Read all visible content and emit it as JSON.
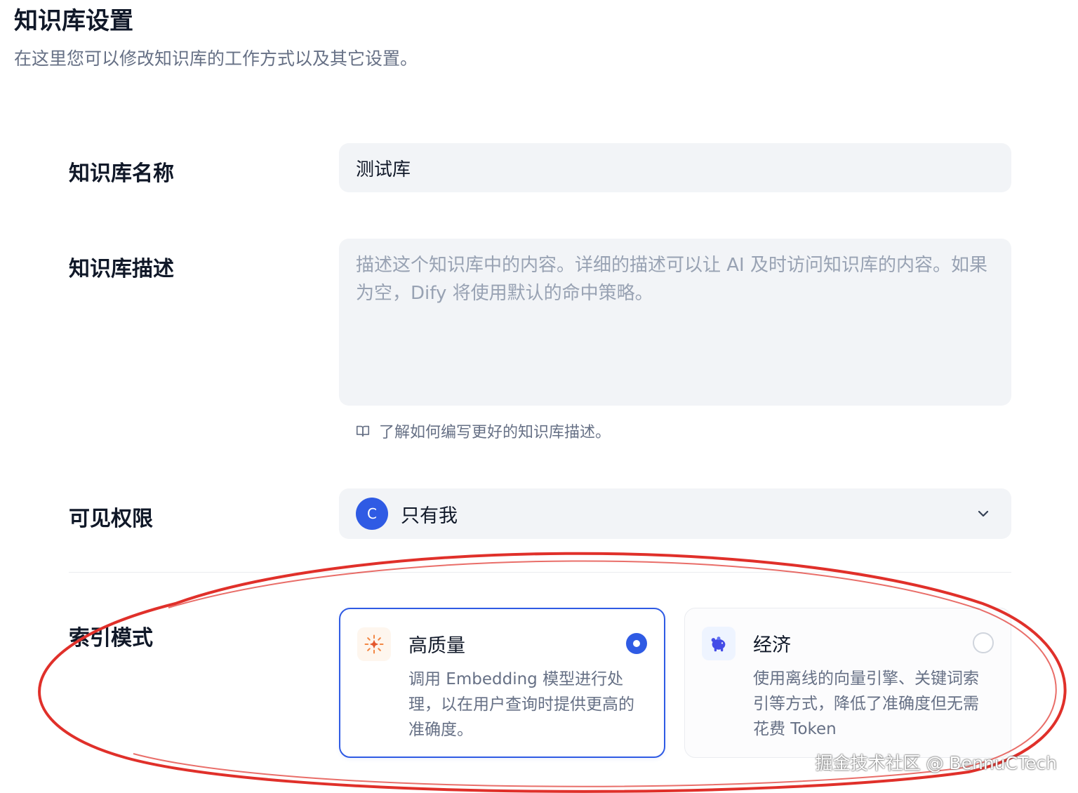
{
  "header": {
    "title": "知识库设置",
    "subtitle": "在这里您可以修改知识库的工作方式以及其它设置。"
  },
  "fields": {
    "name": {
      "label": "知识库名称",
      "value": "测试库"
    },
    "description": {
      "label": "知识库描述",
      "placeholder": "描述这个知识库中的内容。详细的描述可以让 AI 及时访问知识库的内容。如果为空，Dify 将使用默认的命中策略。",
      "help_link": "了解如何编写更好的知识库描述。"
    },
    "permission": {
      "label": "可见权限",
      "avatar_letter": "C",
      "value": "只有我"
    },
    "index_mode": {
      "label": "索引模式",
      "options": [
        {
          "title": "高质量",
          "description": "调用 Embedding 模型进行处理，以在用户查询时提供更高的准确度。",
          "selected": true,
          "icon": "sparkle-icon"
        },
        {
          "title": "经济",
          "description": "使用离线的向量引擎、关键词索引等方式，降低了准确度但无需花费 Token",
          "selected": false,
          "icon": "piggy-bank-icon"
        }
      ]
    }
  },
  "watermark": "掘金技术社区 @ BennuCTech",
  "colors": {
    "accent": "#2f5be4",
    "annotation": "#e0302a"
  }
}
